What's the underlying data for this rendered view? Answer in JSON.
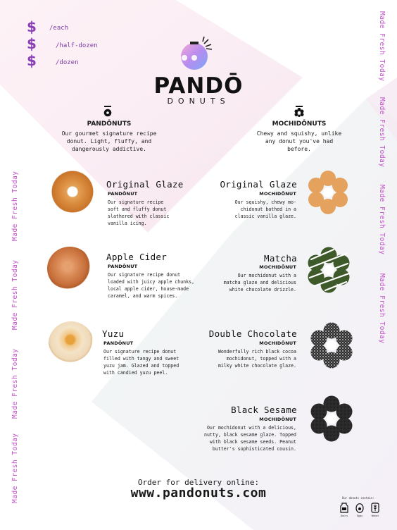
{
  "prices": [
    {
      "symbol": "$",
      "label": "/each"
    },
    {
      "symbol": "$",
      "label": "/half-dozen"
    },
    {
      "symbol": "$",
      "label": "/dozen"
    }
  ],
  "side_text": "Made Fresh Today",
  "brand": {
    "name": "PANDŌ",
    "sub": "DONUTS"
  },
  "categories": {
    "pandonuts": {
      "title": "PANDŌNUTS",
      "desc_lines": [
        "Our gourmet signature recipe",
        "donut. Light, fluffy, and",
        "dangerously addictive."
      ]
    },
    "mochidonuts": {
      "title": "MOCHIDŌNUTS",
      "desc_lines": [
        "Chewy and squishy, unlike",
        "any donut you've had",
        "before."
      ]
    }
  },
  "left_items": [
    {
      "name": "Original Glaze",
      "type": "PANDŌNUT",
      "desc_lines": [
        "Our signature recipe",
        "soft and fluffy donut",
        "slathered with classic",
        "vanilla icing."
      ]
    },
    {
      "name": "Apple Cider",
      "type": "PANDŌNUT",
      "desc_lines": [
        "Our signature recipe donut",
        "loaded with juicy apple chunks,",
        "local apple cider, house-made",
        "caramel, and warm spices."
      ]
    },
    {
      "name": "Yuzu",
      "type": "PANDŌNUT",
      "desc_lines": [
        "Our signature recipe donut",
        "filled with tangy and sweet",
        "yuzu jam. Glazed and topped",
        "with candied yuzu peel."
      ]
    }
  ],
  "right_items": [
    {
      "name": "Original Glaze",
      "type": "MOCHIDŌNUT",
      "desc_lines": [
        "Our squishy, chewy mo-",
        "chidonut bathed in a",
        "classic vanilla glaze."
      ]
    },
    {
      "name": "Matcha",
      "type": "MOCHIDŌNUT",
      "desc_lines": [
        "Our mochidonut with a",
        "matcha glaze and delicious",
        "white chocolate drizzle."
      ]
    },
    {
      "name": "Double Chocolate",
      "type": "MOCHIDŌNUT",
      "desc_lines": [
        "Wonderfully rich black cocoa",
        "mochidonut, topped with a",
        "milky white chocolate glaze."
      ]
    },
    {
      "name": "Black Sesame",
      "type": "MOCHIDŌNUT",
      "desc_lines": [
        "Our mochidonut with a delicious,",
        "nutty,  black sesame glaze. Topped",
        "with black sesame seeds. Peanut",
        "butter's sophisticated cousin."
      ]
    }
  ],
  "order": {
    "title": "Order for delivery online:",
    "url": "www.pandonuts.com"
  },
  "allergens": {
    "title": "Our donuts contain:",
    "items": [
      "Dairy",
      "Eggs",
      "Wheat"
    ]
  },
  "colors": {
    "accent": "#8a3fb8",
    "side_text": "#c04fc6",
    "pink_tint": "#fbe7f0",
    "mint_tint": "#e4f3ef"
  }
}
